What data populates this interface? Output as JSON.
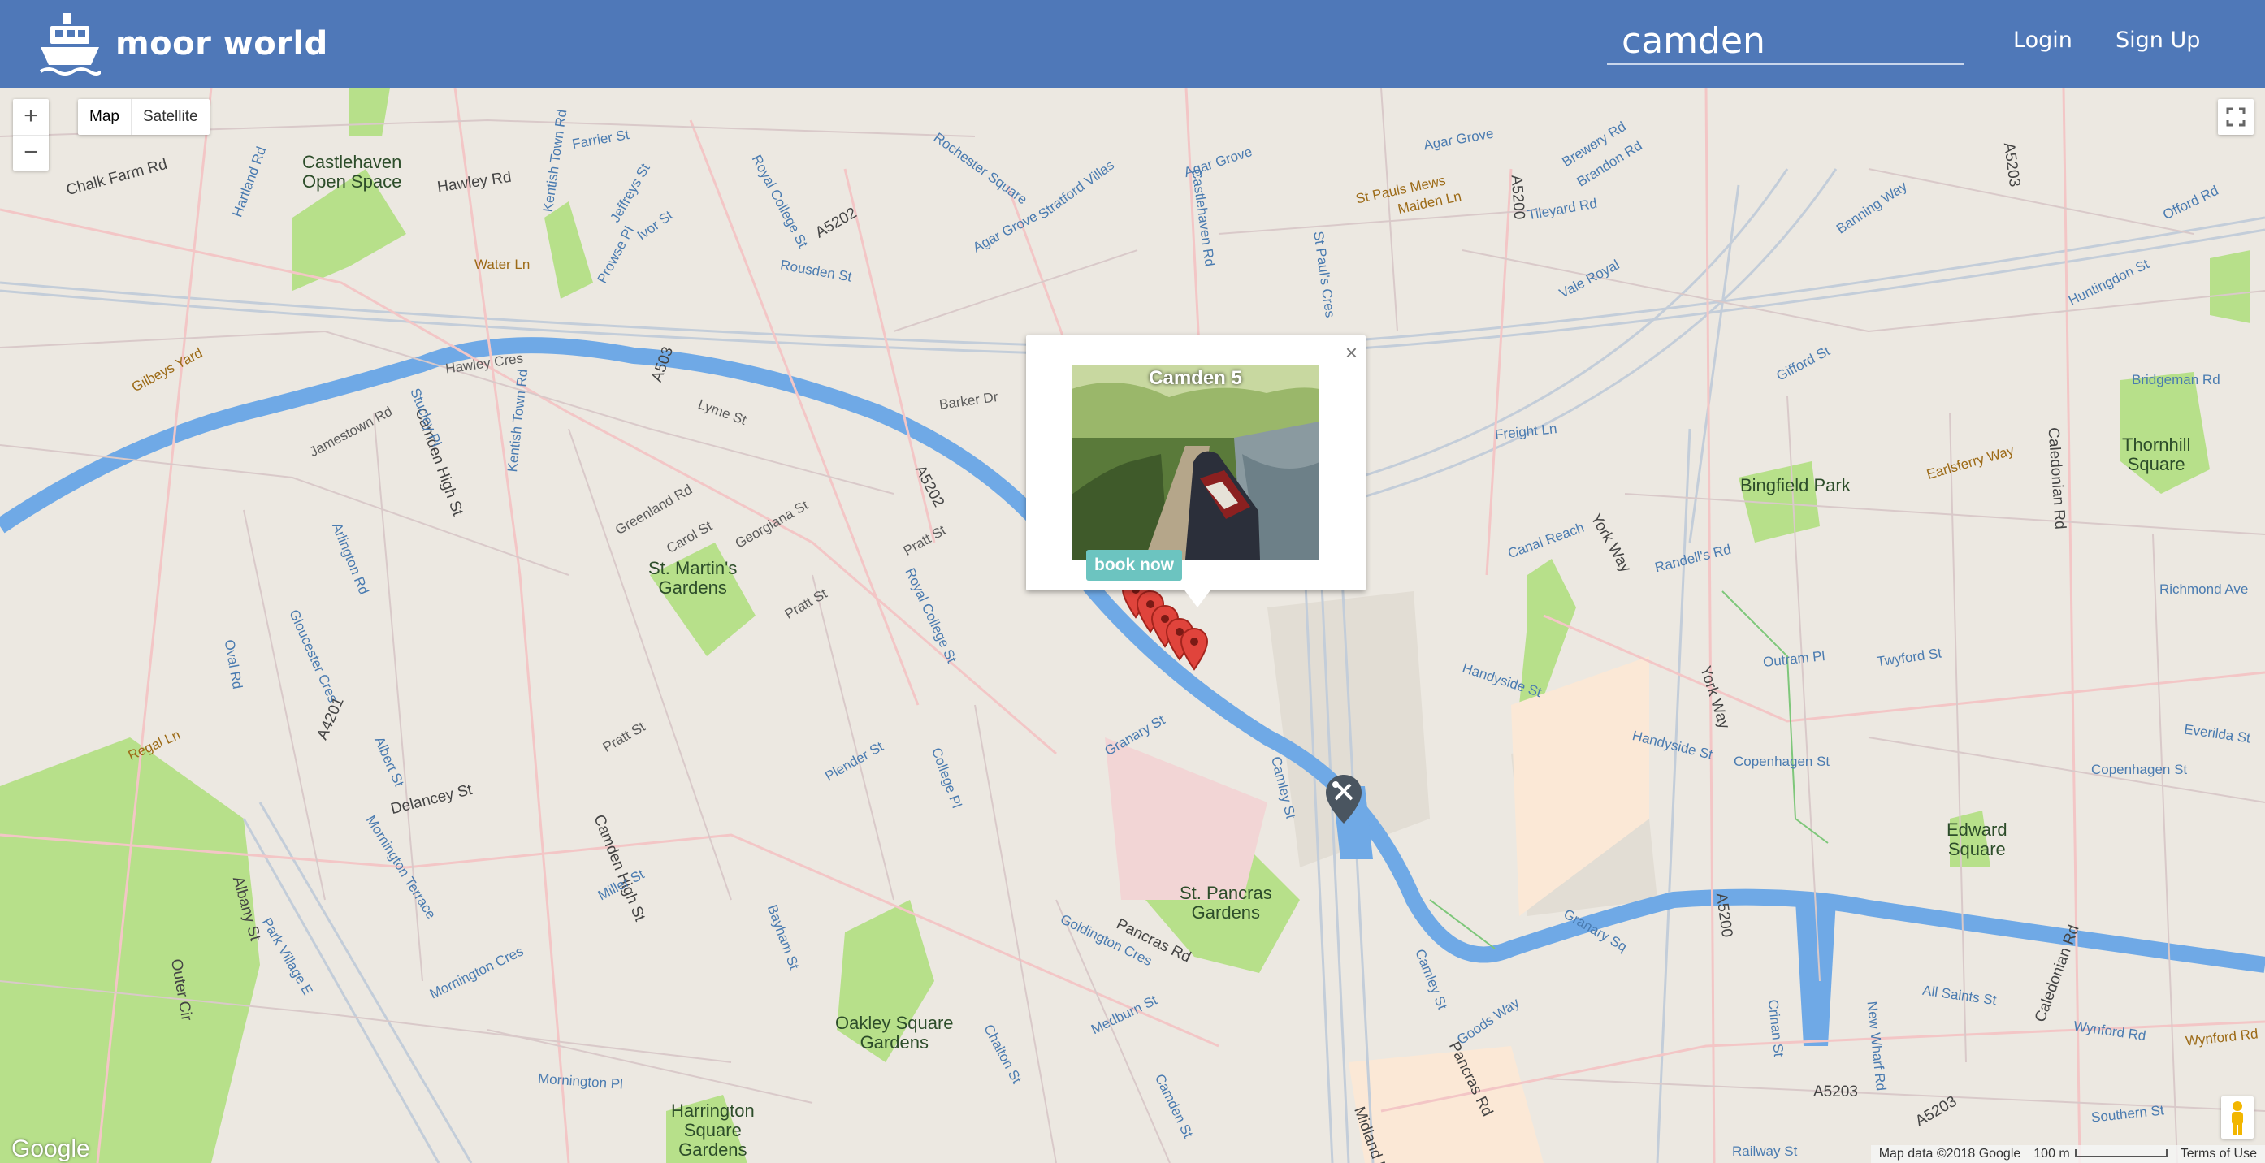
{
  "header": {
    "brand": "moor world",
    "search_value": "camden",
    "login": "Login",
    "signup": "Sign Up",
    "bg_color": "#4f78b8"
  },
  "map": {
    "zoom_in": "+",
    "zoom_out": "−",
    "type_map": "Map",
    "type_satellite": "Satellite",
    "google_logo": "Google",
    "map_data": "Map data ©2018 Google",
    "scale": "100 m",
    "terms": "Terms of Use",
    "areas": {
      "castlehaven": "Castlehaven\nOpen Space",
      "st_martins": "St. Martin's\nGardens",
      "bingfield": "Bingfield Park",
      "thornhill": "Thornhill\nSquare",
      "st_pancras": "St. Pancras\nGardens",
      "edward": "Edward\nSquare",
      "oakley": "Oakley Square\nGardens",
      "harrington": "Harrington\nSquare\nGardens"
    },
    "streets": {
      "chalk_farm": "Chalk Farm Rd",
      "hawley": "Hawley Rd",
      "kentish_town_1": "Kentish Town Rd",
      "kentish_town_2": "Kentish Town Rd",
      "water_ln": "Water Ln",
      "hawley_cres": "Hawley Cres",
      "camden_high_1": "Camden High St",
      "camden_high_2": "Camden High St",
      "jamestown": "Jamestown Rd",
      "gilbeys": "Gilbeys Yard",
      "lyme": "Lyme St",
      "barker": "Barker Dr",
      "a503": "A503",
      "a5202_1": "A5202",
      "a5202_2": "A5202",
      "greenland": "Greenland Rd",
      "carol": "Carol St",
      "georgiana": "Georgiana St",
      "pratt_1": "Pratt St",
      "pratt_2": "Pratt St",
      "pratt_3": "Pratt St",
      "royal_college_1": "Royal College St",
      "royal_college_2": "Royal College St",
      "agar_grove_1": "Agar Grove",
      "agar_grove_2": "Agar Grove",
      "agar_grove_3": "Agar Grove",
      "st_pauls_mews": "St Pauls Mews",
      "maiden": "Maiden Ln",
      "a5200_1": "A5200",
      "a5200_2": "A5200",
      "tileyard": "Tileyard Rd",
      "vale_royal": "Vale Royal",
      "york_way_1": "York Way",
      "york_way_2": "York Way",
      "freight": "Freight Ln",
      "gifford": "Gifford St",
      "caledonian_1": "Caledonian Rd",
      "caledonian_2": "Caledonian Rd",
      "earlsferry": "Earlsferry Way",
      "bridgeman": "Bridgeman Rd",
      "randells": "Randell's Rd",
      "canal_reach": "Canal Reach",
      "handyside_1": "Handyside St",
      "handyside_2": "Handyside St",
      "copenhagen_1": "Copenhagen St",
      "copenhagen_2": "Copenhagen St",
      "richmond": "Richmond Ave",
      "twyford": "Twyford St",
      "everilda": "Everilda St",
      "granary_1": "Granary St",
      "granary_2": "Granary Sq",
      "camley_1": "Camley St",
      "camley_2": "Camley St",
      "pancras_1": "Pancras Rd",
      "pancras_2": "Pancras Rd",
      "goldington": "Goldington Cres",
      "goods_way": "Goods Way",
      "delancey": "Delancey St",
      "regal": "Regal Ln",
      "a4201": "A4201",
      "albany": "Albany St",
      "outer_cir": "Outer Cir",
      "mornington_terr": "Mornington Terrace",
      "mornington_cres": "Mornington Cres",
      "mornington_pl": "Mornington Pl",
      "miller": "Miller St",
      "plender": "Plender St",
      "college_pl": "College Pl",
      "bayham": "Bayham St",
      "medburn": "Medburn St",
      "chalton": "Chalton St",
      "midland": "Midland Rd",
      "a5203_1": "A5203",
      "a5203_2": "A5203",
      "a5203_3": "A5203",
      "all_saints": "All Saints St",
      "wynford_1": "Wynford Rd",
      "wynford_2": "Wynford Rd",
      "southern": "Southern St",
      "railway": "Railway St",
      "crinan": "Crinan St",
      "new_wharf": "New Wharf Rd",
      "outram": "Outram Pl",
      "brewery": "Brewery Rd",
      "brandon": "Brandon Rd",
      "huntingdon": "Huntingdon St",
      "offord": "Offord Rd",
      "banning": "Banning Way",
      "rousden": "Rousden St",
      "rochester": "Rochester Square",
      "stratford": "Stratford Villas",
      "farrier": "Farrier St",
      "st_pauls_cres": "St Paul's Cres",
      "castlehaven_rd": "Castlehaven Rd",
      "ivor": "Ivor St",
      "jeffreys": "Jeffreys St",
      "prowse": "Prowse Pl",
      "hartland": "Hartland Rd",
      "stucley": "Stucley Pl",
      "arlington": "Arlington Rd",
      "gloucester": "Gloucester Cres",
      "oval": "Oval Rd",
      "albert": "Albert St",
      "park_village": "Park Village E",
      "camden_park": "Camden St"
    }
  },
  "popup": {
    "title": "Camden 5",
    "button": "book now",
    "close": "×"
  }
}
